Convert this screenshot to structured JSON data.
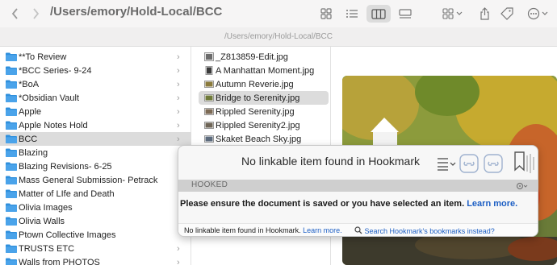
{
  "window": {
    "title": "/Users/emory/Hold-Local/BCC",
    "path": "/Users/emory/Hold-Local/BCC"
  },
  "toolbar": {
    "icons": [
      "chevron-left-icon",
      "chevron-right-icon",
      "icon-view-icon",
      "list-view-icon",
      "column-view-icon",
      "gallery-view-icon",
      "group-icon",
      "share-icon",
      "tag-icon",
      "more-icon"
    ],
    "active_view": "column-view"
  },
  "column1": {
    "items": [
      {
        "label": "**To Review"
      },
      {
        "label": "*BCC Series- 9-24"
      },
      {
        "label": "*BoA"
      },
      {
        "label": "*Obsidian Vault"
      },
      {
        "label": "Apple"
      },
      {
        "label": "Apple Notes Hold"
      },
      {
        "label": "BCC"
      },
      {
        "label": "Blazing"
      },
      {
        "label": "Blazing Revisions- 6-25"
      },
      {
        "label": "Mass General Submission- Petrack"
      },
      {
        "label": "Matter of LIfe and Death"
      },
      {
        "label": "Olivia Images"
      },
      {
        "label": "Olivia Walls"
      },
      {
        "label": "Ptown Collective Images"
      },
      {
        "label": "TRUSTS ETC"
      },
      {
        "label": "Walls from PHOTOS"
      }
    ],
    "selected": "BCC"
  },
  "column2": {
    "items": [
      {
        "label": "_Z813859-Edit.jpg"
      },
      {
        "label": "A Manhattan Moment.jpg"
      },
      {
        "label": "Autumn Reverie.jpg"
      },
      {
        "label": "Bridge to Serenity.jpg"
      },
      {
        "label": "Rippled Serenity.jpg"
      },
      {
        "label": "Rippled Serenity2.jpg"
      },
      {
        "label": "Skaket Beach Sky.jpg"
      }
    ],
    "selected": "Bridge to Serenity.jpg"
  },
  "hookmark": {
    "title": "No linkable item found in Hookmark",
    "section": "HOOKED",
    "message": "Please ensure the document is saved or you have selected an item.",
    "message_link": "Learn more.",
    "footer_text": "No linkable item found in Hookmark.",
    "footer_link": "Learn more.",
    "search_link": "Search Hookmark's bookmarks instead?"
  },
  "colors": {
    "folder_blue": "#2f8fdc",
    "selection_gray": "#dcdcdc",
    "link_blue": "#1d5fc4"
  }
}
